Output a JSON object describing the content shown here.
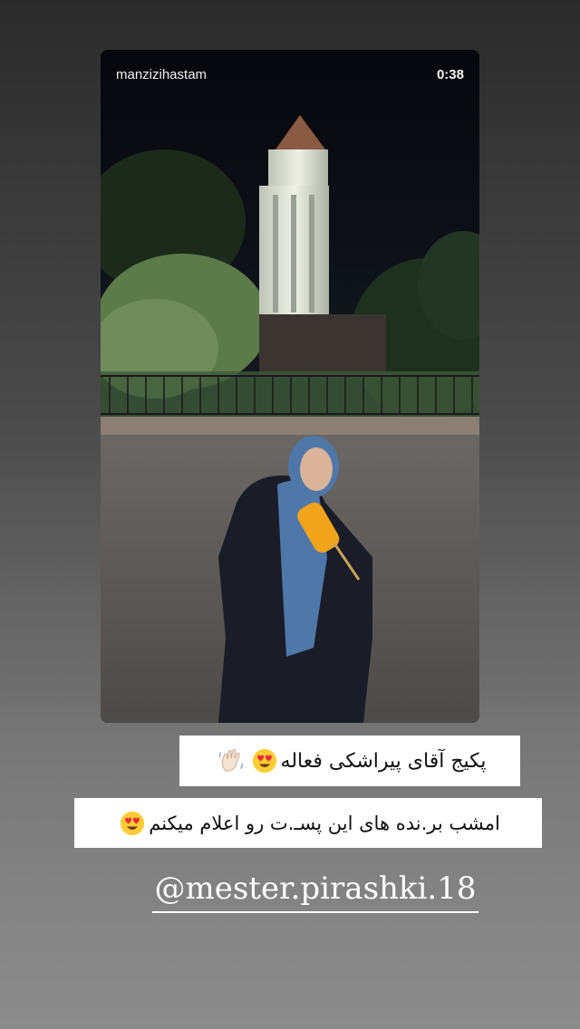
{
  "story": {
    "username": "manzizihastam",
    "duration": "0:38"
  },
  "captions": {
    "line1": "پکیج آقای پیراشکی فعاله",
    "line2": "امشب بر.نده های این پسـ.ت رو اعلام میکنم"
  },
  "mention": {
    "handle": "@mester.pirashki.18"
  },
  "icons": {
    "face": "heart-eyes-emoji-icon",
    "hand": "waving-hand-emoji-icon"
  },
  "colors": {
    "caption_bg": "#ffffff",
    "mention_text": "#ffffff",
    "background_top": "#2b2b2b",
    "background_bottom": "#8c8c8c"
  }
}
